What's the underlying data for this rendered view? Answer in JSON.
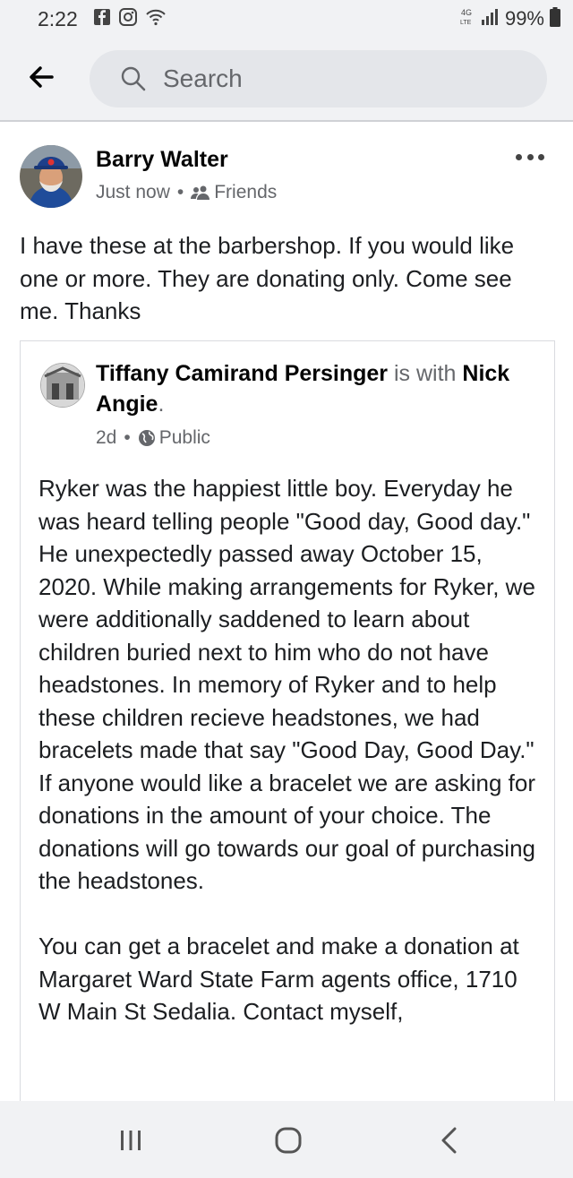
{
  "status_bar": {
    "time": "2:22",
    "icons_left": [
      "facebook-icon",
      "instagram-icon",
      "wifi-icon"
    ],
    "icons_right": [
      "4g-lte-icon",
      "signal-icon",
      "battery-icon"
    ],
    "battery": "99%"
  },
  "app_bar": {
    "back_icon": "back-arrow-icon",
    "search_placeholder": "Search"
  },
  "post": {
    "author": "Barry Walter",
    "time": "Just now",
    "audience": "Friends",
    "text": "I have these at the barbershop.  If you would like one or more. They are donating only. Come see me. Thanks",
    "shared": {
      "author": "Tiffany Camirand Persinger",
      "with_text": "is with",
      "tagged": "Nick Angie",
      "time": "2d",
      "audience": "Public",
      "paragraph1": "Ryker was the happiest little boy. Everyday he was heard telling people \"Good day, Good day.\" He unexpectedly passed away October 15, 2020. While making arrangements for Ryker, we were additionally saddened to learn about children buried next to him who do not have headstones. In memory of Ryker and to help these children recieve headstones, we had bracelets made that say \"Good Day, Good Day.\" If anyone would like a bracelet we are asking for donations in the amount of your choice. The donations will go towards our goal of purchasing the headstones.",
      "paragraph2": "You can get a bracelet and make a donation at Margaret Ward State Farm agents office, 1710 W Main St Sedalia. Contact myself,"
    }
  },
  "nav_bar": {
    "icons": [
      "recent-apps-icon",
      "home-icon",
      "back-icon"
    ]
  }
}
